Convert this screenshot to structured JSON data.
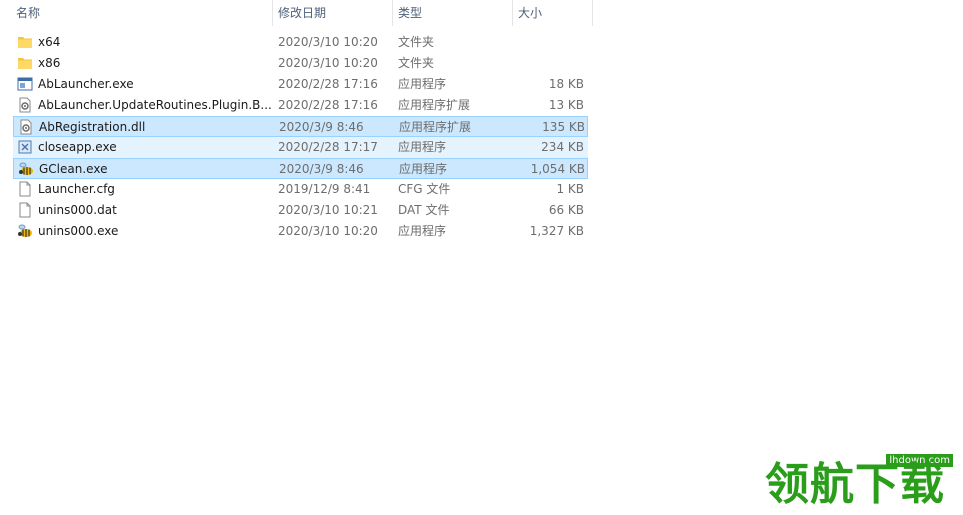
{
  "columns": {
    "name": "名称",
    "date": "修改日期",
    "type": "类型",
    "size": "大小"
  },
  "files": [
    {
      "name": "x64",
      "date": "2020/3/10 10:20",
      "type": "文件夹",
      "size": "",
      "icon": "folder-icon",
      "state": "normal"
    },
    {
      "name": "x86",
      "date": "2020/3/10 10:20",
      "type": "文件夹",
      "size": "",
      "icon": "folder-icon",
      "state": "normal"
    },
    {
      "name": "AbLauncher.exe",
      "date": "2020/2/28 17:16",
      "type": "应用程序",
      "size": "18 KB",
      "icon": "app-window-icon",
      "state": "normal"
    },
    {
      "name": "AbLauncher.UpdateRoutines.Plugin.B...",
      "date": "2020/2/28 17:16",
      "type": "应用程序扩展",
      "size": "13 KB",
      "icon": "dll-gear-icon",
      "state": "normal"
    },
    {
      "name": "AbRegistration.dll",
      "date": "2020/3/9 8:46",
      "type": "应用程序扩展",
      "size": "135 KB",
      "icon": "dll-gear-icon",
      "state": "selected"
    },
    {
      "name": "closeapp.exe",
      "date": "2020/2/28 17:17",
      "type": "应用程序",
      "size": "234 KB",
      "icon": "closeapp-icon",
      "state": "hover"
    },
    {
      "name": "GClean.exe",
      "date": "2020/3/9 8:46",
      "type": "应用程序",
      "size": "1,054 KB",
      "icon": "bee-icon",
      "state": "selected"
    },
    {
      "name": "Launcher.cfg",
      "date": "2019/12/9 8:41",
      "type": "CFG 文件",
      "size": "1 KB",
      "icon": "blank-file-icon",
      "state": "normal"
    },
    {
      "name": "unins000.dat",
      "date": "2020/3/10 10:21",
      "type": "DAT 文件",
      "size": "66 KB",
      "icon": "blank-file-icon",
      "state": "normal"
    },
    {
      "name": "unins000.exe",
      "date": "2020/3/10 10:20",
      "type": "应用程序",
      "size": "1,327 KB",
      "icon": "bee-icon",
      "state": "normal"
    }
  ],
  "watermark": {
    "text": "领航下载",
    "site": "lhdown.com"
  },
  "colors": {
    "selected_bg": "#cce8ff",
    "selected_border": "#99d1ff",
    "hover_bg": "#e5f3ff",
    "folder": "#f5c542",
    "watermark": "#2a9d1a"
  }
}
